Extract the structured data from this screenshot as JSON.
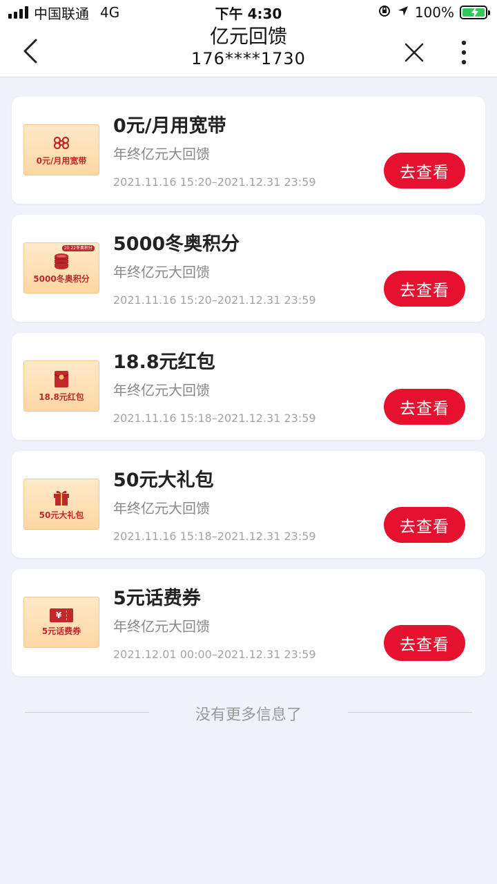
{
  "status_bar": {
    "carrier": "中国联通",
    "network": "4G",
    "time": "下午 4:30",
    "battery": "100%"
  },
  "nav": {
    "title": "亿元回馈",
    "subtitle": "176****1730"
  },
  "cards": [
    {
      "title": "0元/月用宽带",
      "subtitle": "年终亿元大回馈",
      "date": "2021.11.16 15:20–2021.12.31 23:59",
      "thumb_label": "0元/月用宽带",
      "thumb_icon": "unicom-logo-icon",
      "button": "去查看"
    },
    {
      "title": "5000冬奥积分",
      "subtitle": "年终亿元大回馈",
      "date": "2021.11.16 15:20–2021.12.31 23:59",
      "thumb_label": "5000冬奥积分",
      "thumb_icon": "coins-icon",
      "thumb_tag": "20.22冬奥积分",
      "button": "去查看"
    },
    {
      "title": "18.8元红包",
      "subtitle": "年终亿元大回馈",
      "date": "2021.11.16 15:18–2021.12.31 23:59",
      "thumb_label": "18.8元红包",
      "thumb_icon": "red-envelope-icon",
      "button": "去查看"
    },
    {
      "title": "50元大礼包",
      "subtitle": "年终亿元大回馈",
      "date": "2021.11.16 15:18–2021.12.31 23:59",
      "thumb_label": "50元大礼包",
      "thumb_icon": "gift-box-icon",
      "button": "去查看"
    },
    {
      "title": "5元话费券",
      "subtitle": "年终亿元大回馈",
      "date": "2021.12.01 00:00–2021.12.31 23:59",
      "thumb_label": "5元话费券",
      "thumb_icon": "coupon-icon",
      "thumb_glyph": "¥",
      "button": "去查看"
    }
  ],
  "footer": {
    "text": "没有更多信息了"
  },
  "colors": {
    "accent": "#e6112e",
    "background": "#eff2fa",
    "thumb_text": "#c1282c",
    "battery": "#34c759"
  }
}
